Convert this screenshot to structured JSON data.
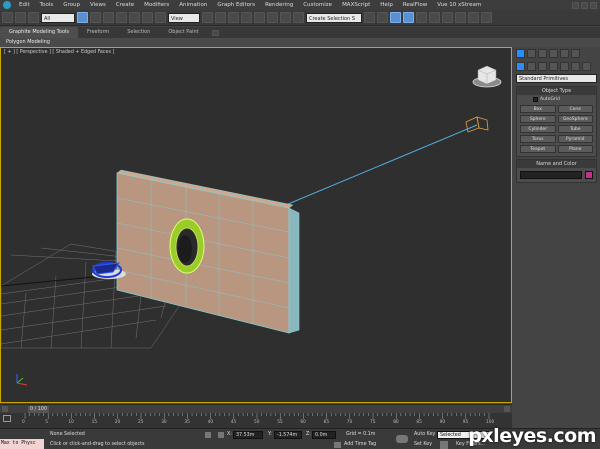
{
  "menubar": {
    "items": [
      "Edit",
      "Tools",
      "Group",
      "Views",
      "Create",
      "Modifiers",
      "Animation",
      "Graph Editors",
      "Rendering",
      "Customize",
      "MAXScript",
      "Help",
      "RealFlow",
      "Vue 10 xStream"
    ]
  },
  "toolbar": {
    "filter_value": "All",
    "view_value": "View",
    "selection_set_value": "Create Selection S"
  },
  "ribbon": {
    "tabs": [
      "Graphite Modeling Tools",
      "Freeform",
      "Selection",
      "Object Paint"
    ],
    "subpanel": "Polygon Modeling"
  },
  "viewport": {
    "label": "[ + ] [ Perspective ] [ Shaded + Edged Faces ]"
  },
  "command_panel": {
    "category_value": "Standard Primitives",
    "object_type_title": "Object Type",
    "autogrid_label": "AutoGrid",
    "primitives": [
      "Box",
      "Cone",
      "Sphere",
      "GeoSphere",
      "Cylinder",
      "Tube",
      "Torus",
      "Pyramid",
      "Teapot",
      "Plane"
    ],
    "name_color_title": "Name and Color",
    "object_color": "#c0328a"
  },
  "timeline": {
    "frame_counter": "0 / 100",
    "ticks": [
      "0",
      "5",
      "10",
      "15",
      "20",
      "25",
      "30",
      "35",
      "40",
      "45",
      "50",
      "55",
      "60",
      "65",
      "70",
      "75",
      "80",
      "85",
      "90",
      "95",
      "100"
    ]
  },
  "status": {
    "listener_text": "Max to Physc",
    "selection_text": "None Selected",
    "prompt_text": "Click or click-and-drag to select objects",
    "x_label": "X:",
    "x_value": "37.53m",
    "y_label": "Y:",
    "y_value": "-1.574m",
    "z_label": "Z:",
    "z_value": "0.0m",
    "grid_text": "Grid = 0.1m",
    "add_time_tag": "Add Time Tag",
    "auto_key": "Auto Key",
    "set_key": "Set Key",
    "selected_value": "Selected",
    "key_filters": "Key Filters..."
  },
  "colors": {
    "viewport_bg": "#2f2f2f",
    "active_viewport_border": "#c8a800",
    "wall_face": "#b99680",
    "wall_edge": "#7fd0d8",
    "light_line": "#4fb0e0",
    "grid": "#8a8a8a"
  },
  "watermark": "pxleyes.com"
}
